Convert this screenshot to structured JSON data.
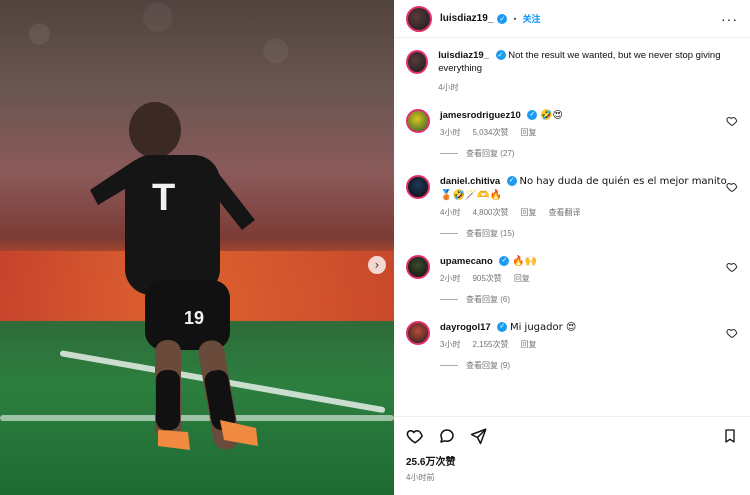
{
  "post": {
    "username": "luisdiaz19_",
    "follow_label": "关注",
    "caption": "Not the result we wanted, but we never stop giving everything",
    "caption_time": "4小时"
  },
  "comments": [
    {
      "username": "jamesrodriguez10",
      "text": "🤣😍",
      "time": "3小时",
      "likes": "5,034次赞",
      "reply_label": "回复",
      "replies_label": "查看回复 (27)"
    },
    {
      "username": "daniel.chitiva",
      "text": "No hay duda de quién es el mejor manito 🥉🤣🪄🫶🔥",
      "time": "4小时",
      "likes": "4,800次赞",
      "reply_label": "回复",
      "translate_label": "查看翻译",
      "replies_label": "查看回复 (15)"
    },
    {
      "username": "upamecano",
      "text": "🔥🙌",
      "time": "2小时",
      "likes": "905次赞",
      "reply_label": "回复",
      "replies_label": "查看回复 (6)"
    },
    {
      "username": "dayrogol17",
      "text": "Mi jugador 😍",
      "time": "3小时",
      "likes": "2,155次赞",
      "reply_label": "回复",
      "replies_label": "查看回复 (9)"
    }
  ],
  "footer": {
    "likes": "25.6万次赞",
    "time": "4小时前"
  },
  "icons": {
    "verified": "verified-badge-icon",
    "heart": "heart-icon",
    "comment": "comment-icon",
    "share": "share-icon",
    "bookmark": "bookmark-icon",
    "more": "more-horizontal-icon",
    "next": "chevron-right-icon"
  },
  "colors": {
    "accent": "#0095f6",
    "verified": "#1d9bf0",
    "ring": "#e1306c",
    "muted": "#737373"
  }
}
